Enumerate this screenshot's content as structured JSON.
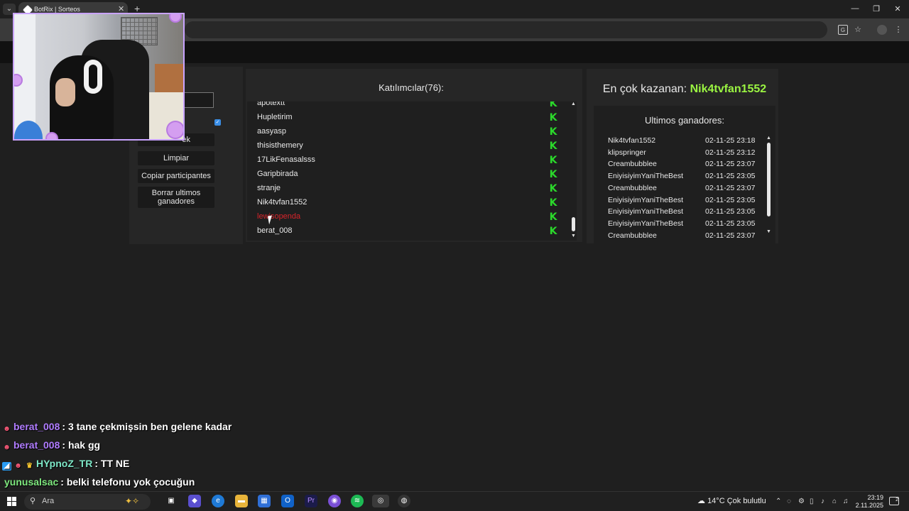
{
  "browser": {
    "tab_title": "BotRix | Sorteos",
    "tab_list_label": "⌄",
    "tab_close_label": "✕",
    "new_tab_label": "+",
    "window_controls": {
      "minimize": "—",
      "restore": "❐",
      "close": "✕"
    }
  },
  "left_panel": {
    "partial_button_label": "ek",
    "limpiar_label": "Limpiar",
    "copiar_label": "Copiar participantes",
    "borrar_label": "Borrar ultimos ganadores"
  },
  "participants": {
    "title": "Katılımcılar(76):",
    "badge_icon": "kick-icon",
    "items": [
      {
        "name": "apotextt",
        "highlight": false
      },
      {
        "name": "Hupletirim",
        "highlight": false
      },
      {
        "name": "aasyasp",
        "highlight": false
      },
      {
        "name": "thisisthemery",
        "highlight": false
      },
      {
        "name": "17LikFenasalsss",
        "highlight": false
      },
      {
        "name": "Garipbirada",
        "highlight": false
      },
      {
        "name": "stranje",
        "highlight": false
      },
      {
        "name": "Nik4tvfan1552",
        "highlight": false
      },
      {
        "name": "lewisopenda",
        "highlight": true
      },
      {
        "name": "berat_008",
        "highlight": false
      }
    ]
  },
  "winners": {
    "top_label": "En çok kazanan:",
    "top_name": "Nik4tvfan1552",
    "list_title": "Ultimos ganadores:",
    "items": [
      {
        "name": "Nik4tvfan1552",
        "time": "02-11-25 23:18"
      },
      {
        "name": "klipspringer",
        "time": "02-11-25 23:12"
      },
      {
        "name": "Creambubblee",
        "time": "02-11-25 23:07"
      },
      {
        "name": "EniyisiyimYaniTheBest",
        "time": "02-11-25 23:05"
      },
      {
        "name": "Creambubblee",
        "time": "02-11-25 23:07"
      },
      {
        "name": "EniyisiyimYaniTheBest",
        "time": "02-11-25 23:05"
      },
      {
        "name": "EniyisiyimYaniTheBest",
        "time": "02-11-25 23:05"
      },
      {
        "name": "EniyisiyimYaniTheBest",
        "time": "02-11-25 23:05"
      },
      {
        "name": "Creambubblee",
        "time": "02-11-25 23:07"
      }
    ]
  },
  "chat": {
    "messages": [
      {
        "user": "berat_008",
        "user_color": "#b07cff",
        "badges": [
          "devil"
        ],
        "text": ": 3 tane çekmişsin ben gelene kadar"
      },
      {
        "user": "berat_008",
        "user_color": "#b07cff",
        "badges": [
          "devil"
        ],
        "text": ": hak gg"
      },
      {
        "user": "HYpnoZ_TR",
        "user_color": "#7ee8c8",
        "badges": [
          "blue",
          "devil",
          "crown"
        ],
        "text": ": TT NE"
      },
      {
        "user": "yunusalsac",
        "user_color": "#7ee87e",
        "badges": [],
        "text": ": belki telefonu yok çocuğun"
      }
    ]
  },
  "taskbar": {
    "search_placeholder": "Ara",
    "weather": "14°C  Çok bulutlu",
    "time": "23:19",
    "date": "2.11.2025",
    "notification_count": "2"
  },
  "colors": {
    "accent_green": "#9bf542",
    "kick_green": "#2bd92b",
    "highlight_red": "#d8242a"
  }
}
